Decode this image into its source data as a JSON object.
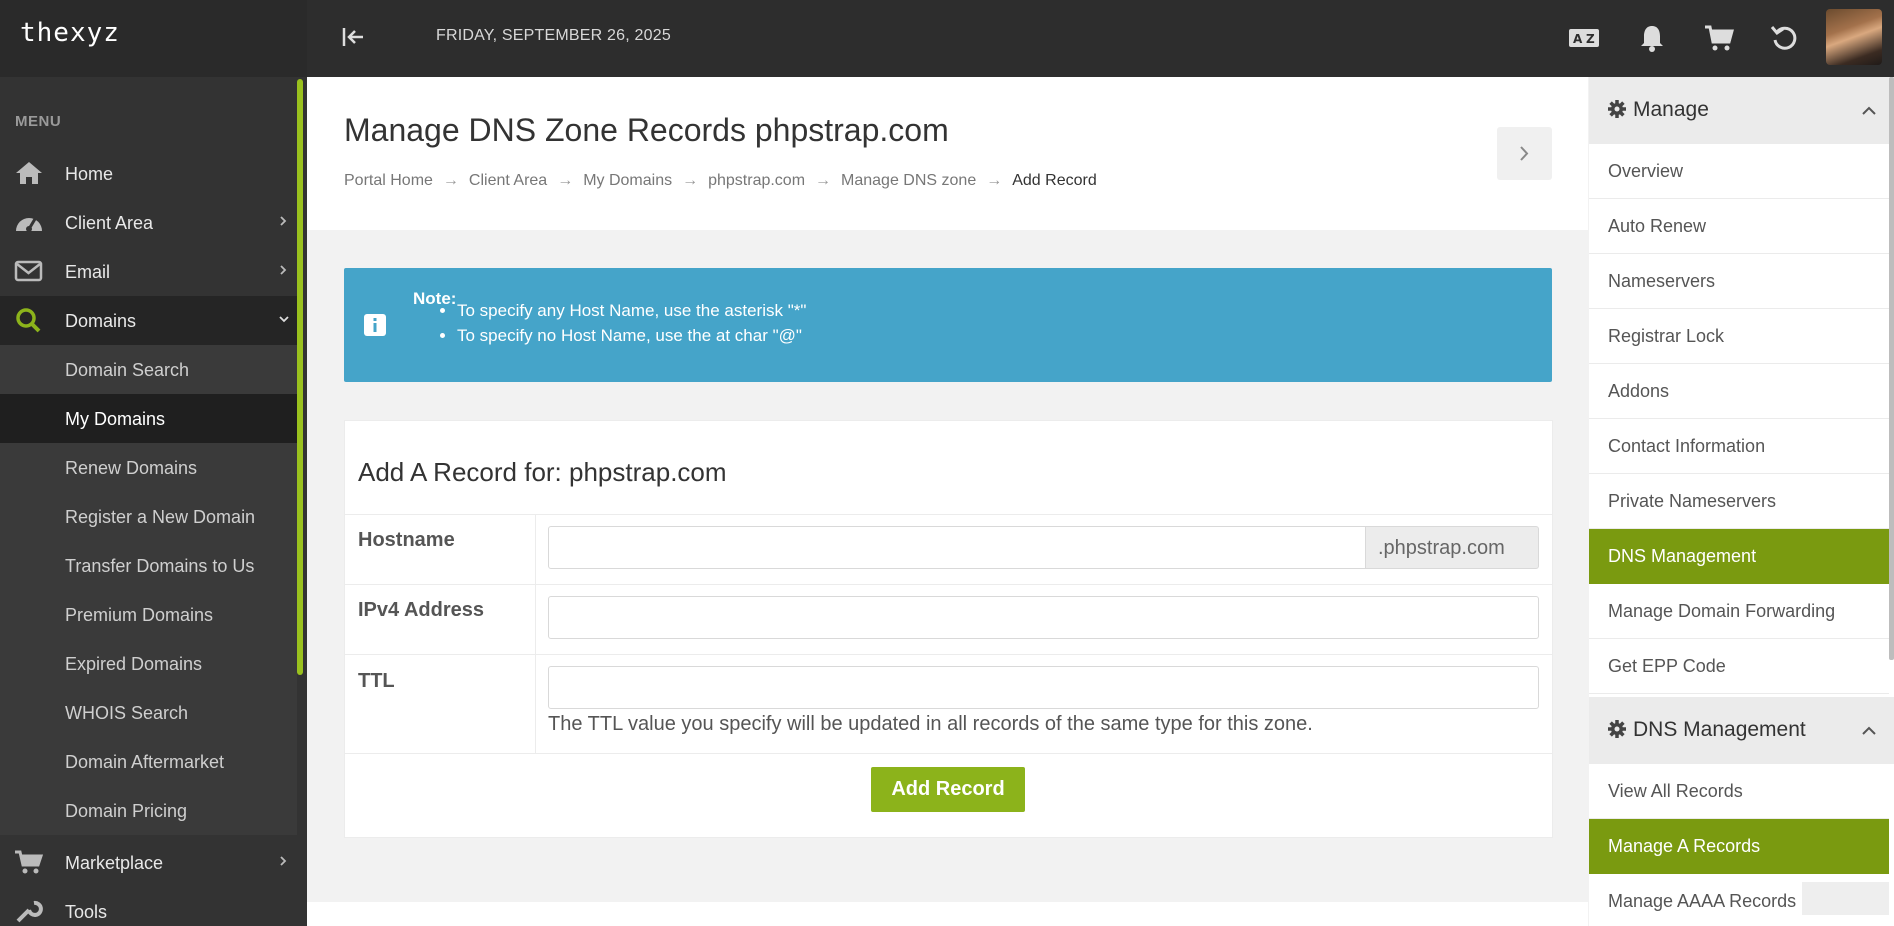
{
  "topbar": {
    "logo": "thexyz",
    "date": "FRIDAY, SEPTEMBER 26, 2025",
    "icons": [
      "collapse-sidebar-icon",
      "translate-icon",
      "bell-icon",
      "cart-icon",
      "refresh-icon"
    ]
  },
  "sidebar": {
    "menu_title": "MENU",
    "items": [
      {
        "label": "Home",
        "icon": "home-icon"
      },
      {
        "label": "Client Area",
        "icon": "dashboard-icon"
      },
      {
        "label": "Email",
        "icon": "envelope-icon"
      },
      {
        "label": "Domains",
        "icon": "search-icon"
      },
      {
        "label": "Marketplace",
        "icon": "cart-icon"
      },
      {
        "label": "Tools",
        "icon": "wrench-icon"
      }
    ],
    "sub_items": [
      "Domain Search",
      "My Domains",
      "Renew Domains",
      "Register a New Domain",
      "Transfer Domains to Us",
      "Premium Domains",
      "Expired Domains",
      "WHOIS Search",
      "Domain Aftermarket",
      "Domain Pricing"
    ]
  },
  "header": {
    "title": "Manage DNS Zone Records phpstrap.com",
    "breadcrumb": [
      "Portal Home",
      "Client Area",
      "My Domains",
      "phpstrap.com",
      "Manage DNS zone",
      "Add Record"
    ]
  },
  "note": {
    "title": "Note:",
    "items": [
      "To specify any Host Name, use the asterisk \"*\"",
      "To specify no Host Name, use the at char \"@\""
    ]
  },
  "form": {
    "title": "Add A Record for: phpstrap.com",
    "hostname_label": "Hostname",
    "hostname_value": "",
    "hostname_suffix": ".phpstrap.com",
    "ipv4_label": "IPv4 Address",
    "ipv4_value": "",
    "ttl_label": "TTL",
    "ttl_value": "",
    "ttl_help": "The TTL value you specify will be updated in all records of the same type for this zone.",
    "submit_label": "Add Record"
  },
  "right_panel": {
    "manage_title": "Manage",
    "manage_items": [
      "Overview",
      "Auto Renew",
      "Nameservers",
      "Registrar Lock",
      "Addons",
      "Contact Information",
      "Private Nameservers",
      "DNS Management",
      "Manage Domain Forwarding",
      "Get EPP Code"
    ],
    "manage_active": "DNS Management",
    "dns_title": "DNS Management",
    "dns_items": [
      "View All Records",
      "Manage A Records",
      "Manage AAAA Records"
    ],
    "dns_active": "Manage A Records"
  },
  "colors": {
    "accent_green": "#8cb31b",
    "active_green": "#7a9a10",
    "note_blue": "#45a4c9",
    "sidebar_bg": "#333333",
    "topbar_bg": "#2d2d2d"
  }
}
